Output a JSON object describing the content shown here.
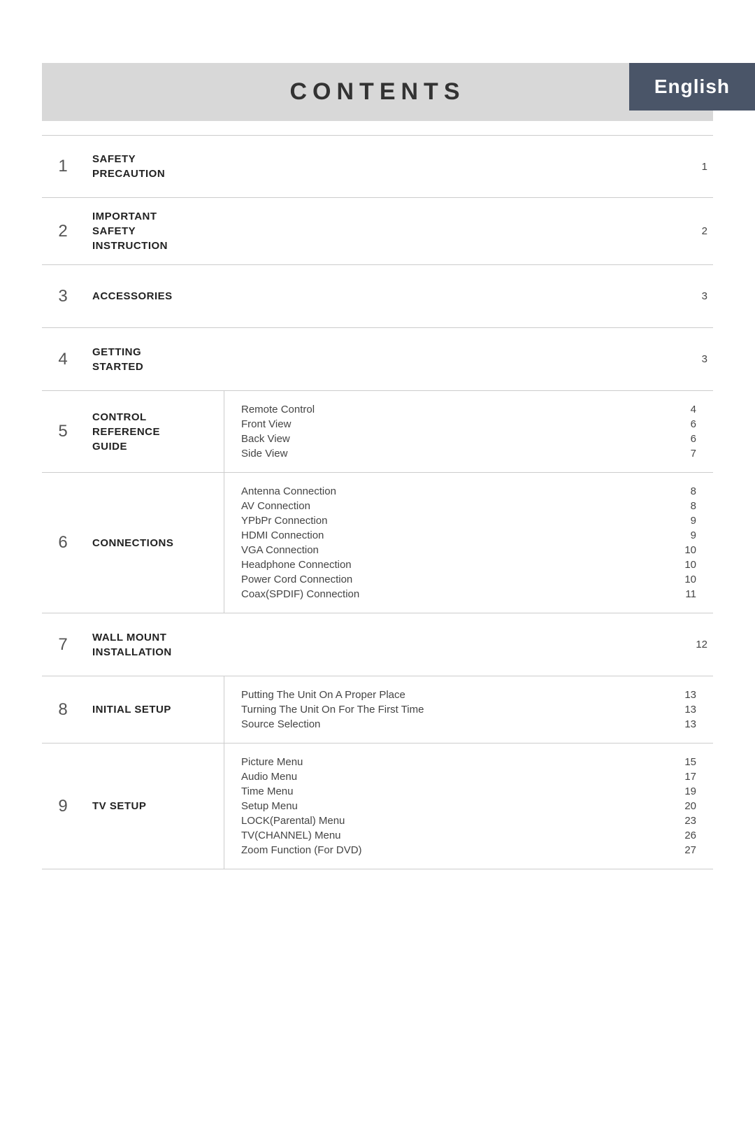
{
  "header": {
    "language": "English",
    "title": "CONTENTS"
  },
  "sections": [
    {
      "num": "1",
      "label": "SAFETY\nPRECAUTION",
      "sub_items": [],
      "page": "1"
    },
    {
      "num": "2",
      "label": "IMPORTANT\nSAFETY\nINSTRUCTION",
      "sub_items": [],
      "page": "2"
    },
    {
      "num": "3",
      "label": "ACCESSORIES",
      "sub_items": [],
      "page": "3"
    },
    {
      "num": "4",
      "label": "GETTING\nSTARTED",
      "sub_items": [],
      "page": "3"
    },
    {
      "num": "5",
      "label": "CONTROL\nREFERENCE\nGUIDE",
      "sub_items": [
        {
          "text": "Remote Control",
          "page": "4"
        },
        {
          "text": "Front View",
          "page": "6"
        },
        {
          "text": "Back View",
          "page": "6"
        },
        {
          "text": "Side View",
          "page": "7"
        }
      ],
      "page": null
    },
    {
      "num": "6",
      "label": "CONNECTIONS",
      "sub_items": [
        {
          "text": "Antenna Connection",
          "page": "8"
        },
        {
          "text": "AV Connection",
          "page": "8"
        },
        {
          "text": "YPbPr Connection",
          "page": "9"
        },
        {
          "text": "HDMI Connection",
          "page": "9"
        },
        {
          "text": "VGA Connection",
          "page": "10"
        },
        {
          "text": "Headphone Connection",
          "page": "10"
        },
        {
          "text": "Power Cord Connection",
          "page": "10"
        },
        {
          "text": "Coax(SPDIF) Connection",
          "page": "11"
        }
      ],
      "page": null
    },
    {
      "num": "7",
      "label": "WALL MOUNT\nINSTALLATION",
      "sub_items": [],
      "page": "12"
    },
    {
      "num": "8",
      "label": "INITIAL SETUP",
      "sub_items": [
        {
          "text": "Putting The Unit On A Proper Place",
          "page": "13"
        },
        {
          "text": "Turning The Unit On For The First Time",
          "page": "13"
        },
        {
          "text": "Source Selection",
          "page": "13"
        }
      ],
      "page": null
    },
    {
      "num": "9",
      "label": "TV SETUP",
      "sub_items": [
        {
          "text": "Picture Menu",
          "page": "15"
        },
        {
          "text": "Audio Menu",
          "page": "17"
        },
        {
          "text": "Time Menu",
          "page": "19"
        },
        {
          "text": "Setup Menu",
          "page": "20"
        },
        {
          "text": "LOCK(Parental) Menu",
          "page": "23"
        },
        {
          "text": "TV(CHANNEL) Menu",
          "page": "26"
        },
        {
          "text": "Zoom Function  (For DVD)",
          "page": "27"
        }
      ],
      "page": null
    }
  ]
}
